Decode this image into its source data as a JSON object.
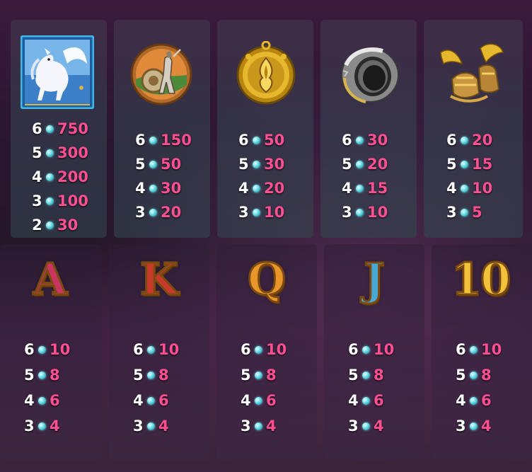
{
  "high_symbols": [
    {
      "icon": "pegasus-icon",
      "pays": [
        {
          "count": "6",
          "value": "750"
        },
        {
          "count": "5",
          "value": "300"
        },
        {
          "count": "4",
          "value": "200"
        },
        {
          "count": "3",
          "value": "100"
        },
        {
          "count": "2",
          "value": "30"
        }
      ]
    },
    {
      "icon": "warrior-shield-icon",
      "pays": [
        {
          "count": "6",
          "value": "150"
        },
        {
          "count": "5",
          "value": "50"
        },
        {
          "count": "4",
          "value": "30"
        },
        {
          "count": "3",
          "value": "20"
        }
      ]
    },
    {
      "icon": "golden-amulet-icon",
      "pays": [
        {
          "count": "6",
          "value": "50"
        },
        {
          "count": "5",
          "value": "30"
        },
        {
          "count": "4",
          "value": "20"
        },
        {
          "count": "3",
          "value": "10"
        }
      ]
    },
    {
      "icon": "silver-ring-icon",
      "pays": [
        {
          "count": "6",
          "value": "30"
        },
        {
          "count": "5",
          "value": "20"
        },
        {
          "count": "4",
          "value": "15"
        },
        {
          "count": "3",
          "value": "10"
        }
      ]
    },
    {
      "icon": "winged-sandals-icon",
      "pays": [
        {
          "count": "6",
          "value": "20"
        },
        {
          "count": "5",
          "value": "15"
        },
        {
          "count": "4",
          "value": "10"
        },
        {
          "count": "3",
          "value": "5"
        }
      ]
    }
  ],
  "low_symbols": [
    {
      "icon": "letter-a-icon",
      "label": "A",
      "color": "#c8355f",
      "pays": [
        {
          "count": "6",
          "value": "10"
        },
        {
          "count": "5",
          "value": "8"
        },
        {
          "count": "4",
          "value": "6"
        },
        {
          "count": "3",
          "value": "4"
        }
      ]
    },
    {
      "icon": "letter-k-icon",
      "label": "K",
      "color": "#c83a2a",
      "pays": [
        {
          "count": "6",
          "value": "10"
        },
        {
          "count": "5",
          "value": "8"
        },
        {
          "count": "4",
          "value": "6"
        },
        {
          "count": "3",
          "value": "4"
        }
      ]
    },
    {
      "icon": "letter-q-icon",
      "label": "Q",
      "color": "#e8962a",
      "pays": [
        {
          "count": "6",
          "value": "10"
        },
        {
          "count": "5",
          "value": "8"
        },
        {
          "count": "4",
          "value": "6"
        },
        {
          "count": "3",
          "value": "4"
        }
      ]
    },
    {
      "icon": "letter-j-icon",
      "label": "J",
      "color": "#4aa9d4",
      "pays": [
        {
          "count": "6",
          "value": "10"
        },
        {
          "count": "5",
          "value": "8"
        },
        {
          "count": "4",
          "value": "6"
        },
        {
          "count": "3",
          "value": "4"
        }
      ]
    },
    {
      "icon": "number-10-icon",
      "label": "10",
      "color": "#f2c23a",
      "pays": [
        {
          "count": "6",
          "value": "10"
        },
        {
          "count": "5",
          "value": "8"
        },
        {
          "count": "4",
          "value": "6"
        },
        {
          "count": "3",
          "value": "4"
        }
      ]
    }
  ]
}
